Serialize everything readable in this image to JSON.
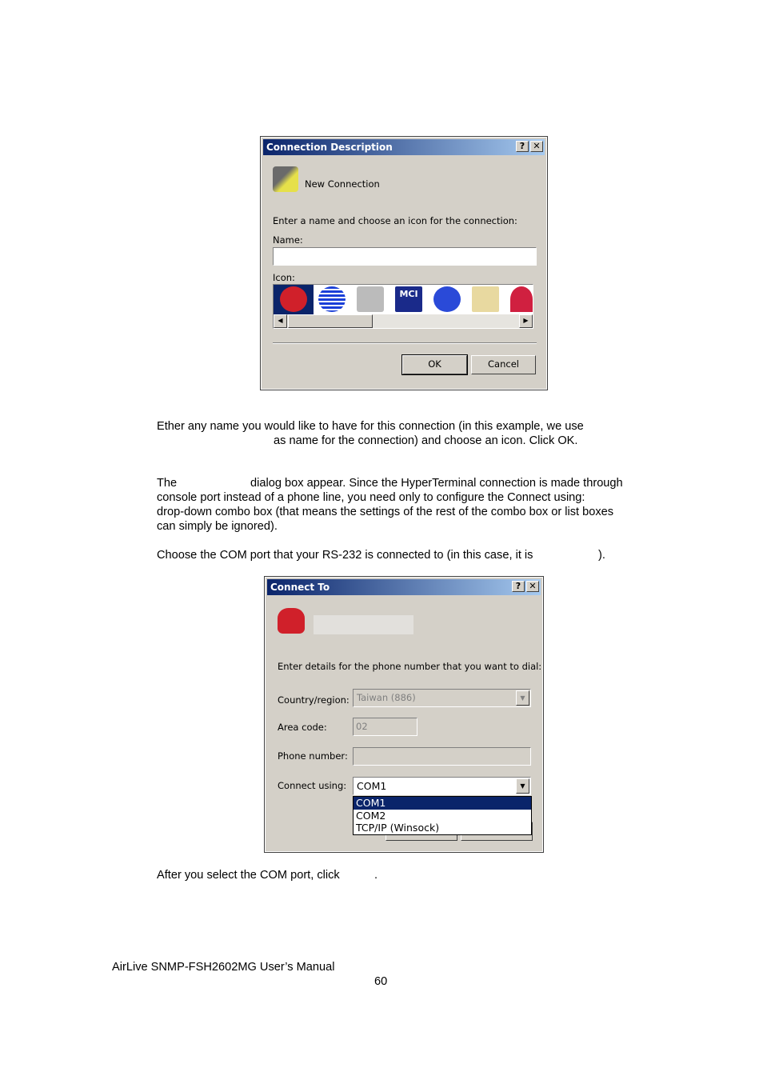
{
  "dialog1": {
    "title": "Connection Description",
    "help": "?",
    "close": "✕",
    "heading": "New Connection",
    "prompt": "Enter a name and choose an icon for the connection:",
    "name_label": "Name:",
    "name_value": "",
    "icon_label": "Icon:",
    "ok": "OK",
    "cancel": "Cancel",
    "icons": [
      "red-phone",
      "globe",
      "fax",
      "MCI",
      "GE",
      "documents",
      "umbrella"
    ]
  },
  "para1": {
    "line1": "Ether any name you would like to have for this connection (in this example, we use",
    "line2": "as name for the connection) and choose an icon. Click OK."
  },
  "para2": {
    "a": "The",
    "b": "dialog box appear. Since the HyperTerminal connection is made through",
    "line2": "console port instead of a phone line, you need only to configure the Connect using:",
    "line3": "drop-down combo box (that means the settings of the rest of the combo box or list boxes",
    "line4": "can simply be ignored)."
  },
  "para3": {
    "a": "Choose the COM port that your RS-232 is connected to (in this case, it is",
    "b": ")."
  },
  "dialog2": {
    "title": "Connect To",
    "help": "?",
    "close": "✕",
    "prompt": "Enter details for the phone number that you want to dial:",
    "country_label": "Country/region:",
    "country_value": "Taiwan (886)",
    "area_label": "Area code:",
    "area_value": "02",
    "phone_label": "Phone number:",
    "phone_value": "",
    "connect_label": "Connect using:",
    "connect_value": "COM1",
    "options": [
      "COM1",
      "COM2",
      "TCP/IP (Winsock)"
    ],
    "selected": "COM1",
    "highlight": "#0a246a"
  },
  "para4": {
    "a": "After you select the COM port, click",
    "b": "."
  },
  "footer": {
    "manual": "AirLive SNMP-FSH2602MG User’s Manual",
    "page": "60"
  }
}
